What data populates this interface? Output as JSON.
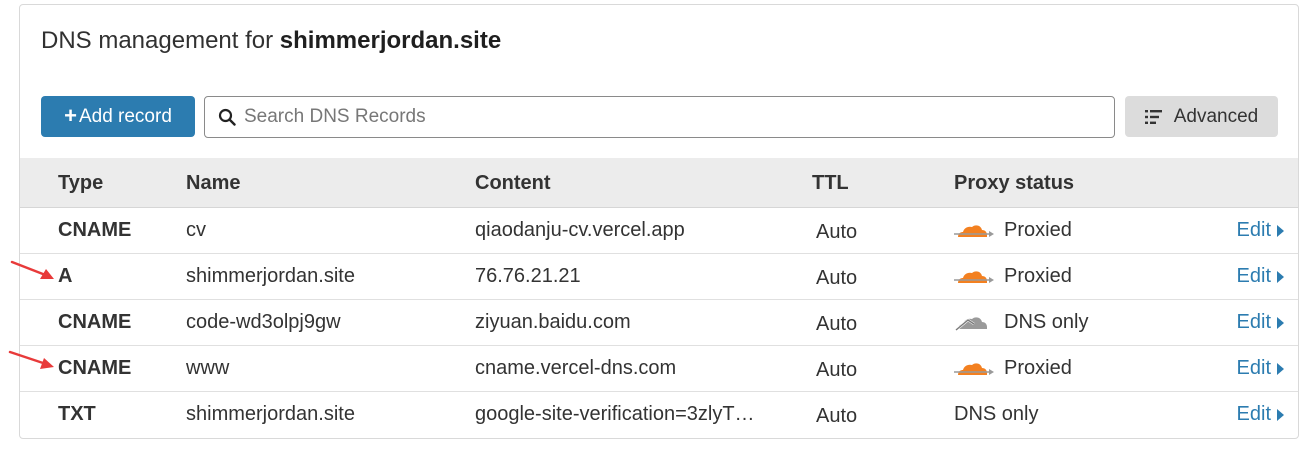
{
  "page": {
    "title_prefix": "DNS management for ",
    "domain": "shimmerjordan.site"
  },
  "toolbar": {
    "add_plus": "+",
    "add_label": "Add record",
    "search_placeholder": "Search DNS Records",
    "advanced_label": "Advanced"
  },
  "table": {
    "headers": {
      "type": "Type",
      "name": "Name",
      "content": "Content",
      "ttl": "TTL",
      "proxy": "Proxy status"
    },
    "rows": [
      {
        "type": "CNAME",
        "name": "cv",
        "content": "qiaodanju-cv.vercel.app",
        "ttl": "Auto",
        "proxy": "Proxied",
        "proxy_icon": "cloud-orange-icon",
        "edit": "Edit"
      },
      {
        "type": "A",
        "name": "shimmerjordan.site",
        "content": "76.76.21.21",
        "ttl": "Auto",
        "proxy": "Proxied",
        "proxy_icon": "cloud-orange-icon",
        "edit": "Edit"
      },
      {
        "type": "CNAME",
        "name": "code-wd3olpj9gw",
        "content": "ziyuan.baidu.com",
        "ttl": "Auto",
        "proxy": "DNS only",
        "proxy_icon": "cloud-gray-icon",
        "edit": "Edit"
      },
      {
        "type": "CNAME",
        "name": "www",
        "content": "cname.vercel-dns.com",
        "ttl": "Auto",
        "proxy": "Proxied",
        "proxy_icon": "cloud-orange-icon",
        "edit": "Edit"
      },
      {
        "type": "TXT",
        "name": "shimmerjordan.site",
        "content": "google-site-verification=3zlyT…",
        "ttl": "Auto",
        "proxy": "DNS only",
        "proxy_icon": "",
        "edit": "Edit"
      }
    ]
  },
  "colors": {
    "accent": "#2c7cb0",
    "proxied_orange": "#f38020",
    "dns_only_gray": "#9a9a9a",
    "annotation_red": "#e83a3a"
  }
}
